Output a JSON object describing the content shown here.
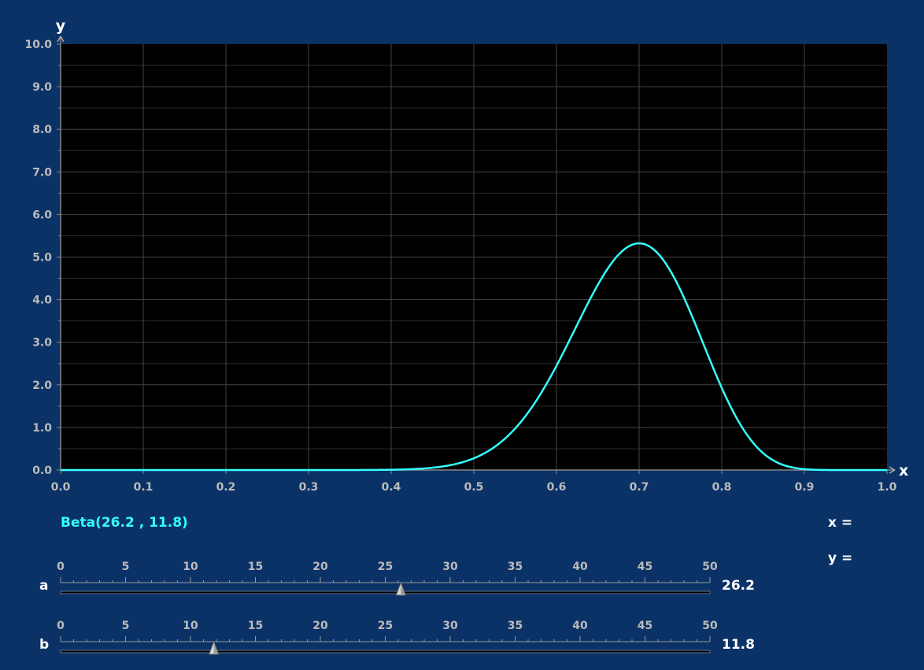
{
  "chart_data": {
    "type": "line",
    "xlabel": "x",
    "ylabel": "y",
    "xlim": [
      0,
      1
    ],
    "ylim": [
      0,
      10
    ],
    "x_ticks": [
      "0.0",
      "0.1",
      "0.2",
      "0.3",
      "0.4",
      "0.5",
      "0.6",
      "0.7",
      "0.8",
      "0.9",
      "1.0"
    ],
    "y_ticks": [
      "0.0",
      "1.0",
      "2.0",
      "3.0",
      "4.0",
      "5.0",
      "6.0",
      "7.0",
      "8.0",
      "9.0",
      "10.0"
    ],
    "grid": true,
    "distribution": {
      "family": "beta",
      "a": 26.2,
      "b": 11.8
    },
    "series": [
      {
        "color": "#33ffff"
      }
    ]
  },
  "formula_label": "Beta(26.2 , 11.8)",
  "readout": {
    "x_label": "x =",
    "y_label": "y ="
  },
  "sliders": [
    {
      "name": "a",
      "value": 26.2,
      "value_text": "26.2",
      "min": 0,
      "max": 50,
      "ticks": [
        "0",
        "5",
        "10",
        "15",
        "20",
        "25",
        "30",
        "35",
        "40",
        "45",
        "50"
      ]
    },
    {
      "name": "b",
      "value": 11.8,
      "value_text": "11.8",
      "min": 0,
      "max": 50,
      "ticks": [
        "0",
        "5",
        "10",
        "15",
        "20",
        "25",
        "30",
        "35",
        "40",
        "45",
        "50"
      ]
    }
  ],
  "colors": {
    "background": "#0b3266",
    "plot_bg": "#000000",
    "grid": "#444444",
    "axis_text": "#bbbbbb",
    "curve": "#33ffff"
  }
}
